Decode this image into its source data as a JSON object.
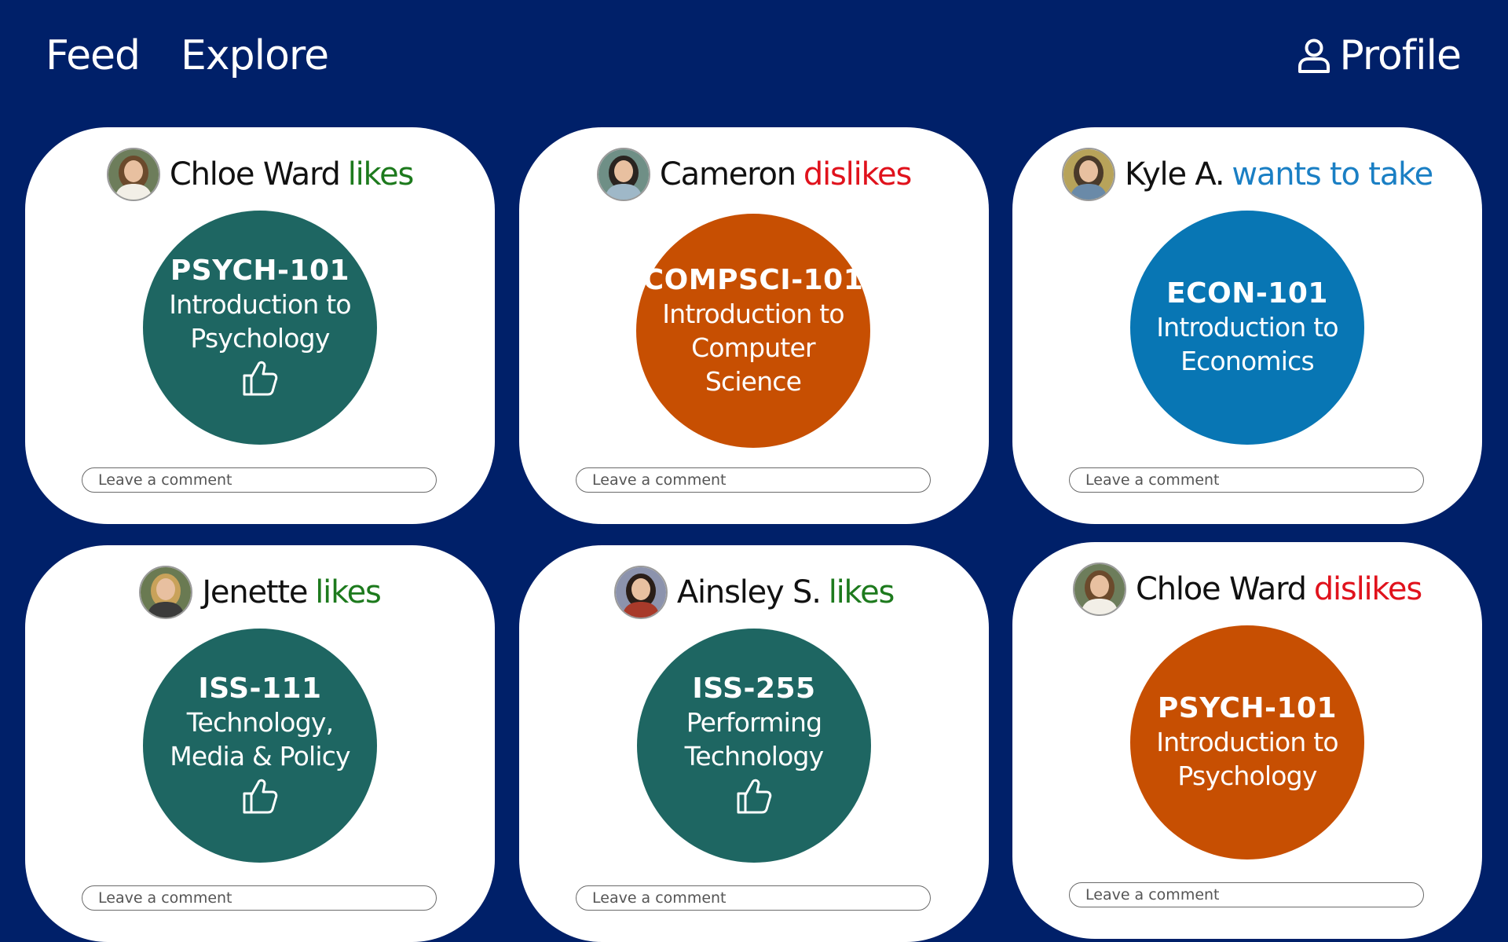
{
  "nav": {
    "feed": "Feed",
    "explore": "Explore",
    "profile": "Profile"
  },
  "cards": [
    {
      "user": "Chloe Ward",
      "action": "likes",
      "action_type": "like",
      "course_code": "PSYCH-101",
      "course_title": "Introduction to Psychology",
      "circle_color": "#1e6662",
      "show_thumb": true,
      "comment_placeholder": "Leave a comment"
    },
    {
      "user": "Cameron",
      "action": "dislikes",
      "action_type": "dislike",
      "course_code": "COMPSCI-101",
      "course_title": "Introduction to Computer Science",
      "circle_color": "#c74f02",
      "show_thumb": false,
      "comment_placeholder": "Leave a comment"
    },
    {
      "user": "Kyle A.",
      "action": "wants to take",
      "action_type": "want",
      "course_code": "ECON-101",
      "course_title": "Introduction to Economics",
      "circle_color": "#0876b4",
      "show_thumb": false,
      "comment_placeholder": "Leave a comment"
    },
    {
      "user": "Jenette",
      "action": "likes",
      "action_type": "like",
      "course_code": "ISS-111",
      "course_title": "Technology, Media & Policy",
      "circle_color": "#1e6662",
      "show_thumb": true,
      "comment_placeholder": "Leave a comment"
    },
    {
      "user": "Ainsley S.",
      "action": "likes",
      "action_type": "like",
      "course_code": "ISS-255",
      "course_title": "Performing Technology",
      "circle_color": "#1e6662",
      "show_thumb": true,
      "comment_placeholder": "Leave a comment"
    },
    {
      "user": "Chloe Ward",
      "action": "dislikes",
      "action_type": "dislike",
      "course_code": "PSYCH-101",
      "course_title": "Introduction to Psychology",
      "circle_color": "#c74f02",
      "show_thumb": false,
      "comment_placeholder": "Leave a comment"
    }
  ],
  "colors": {
    "background": "#002069",
    "card": "#ffffff",
    "like": "#1d7a1d",
    "dislike": "#e0121c",
    "want": "#1a7fc4"
  },
  "icons": {
    "profile": "person-icon",
    "thumb": "thumbs-up-icon",
    "avatar": "user-photo"
  }
}
